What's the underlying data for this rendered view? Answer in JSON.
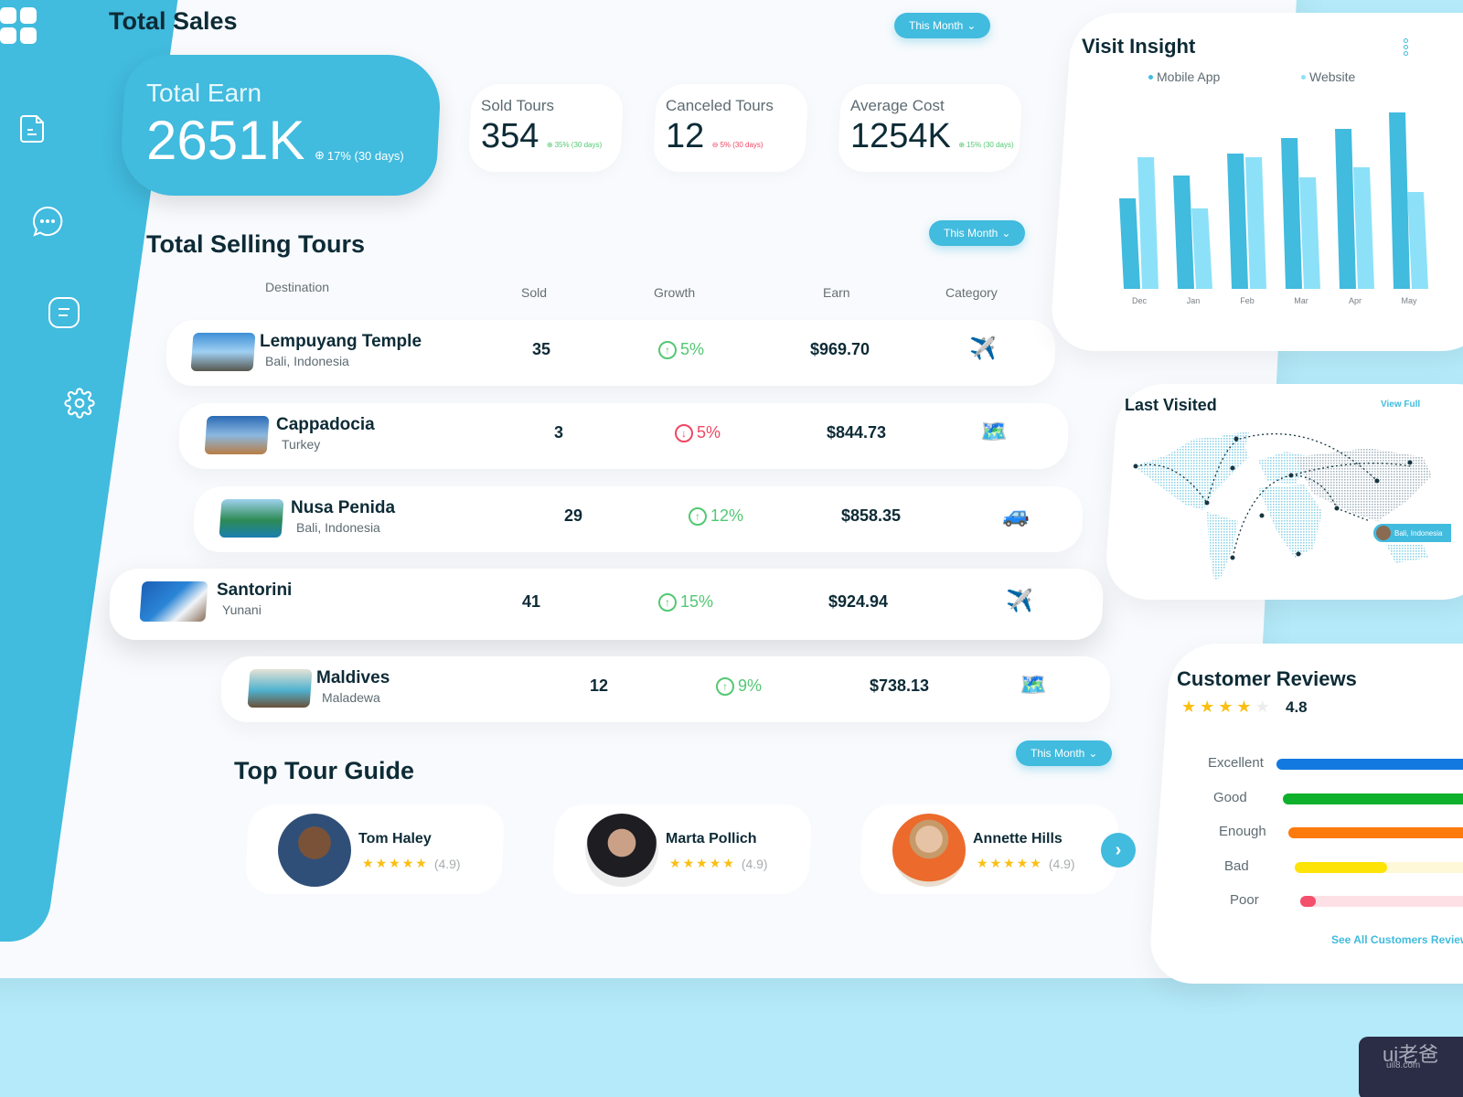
{
  "sidebar": {
    "items": [
      {
        "icon": "document-icon"
      },
      {
        "icon": "chat-icon"
      },
      {
        "icon": "message-icon"
      },
      {
        "icon": "gear-icon"
      }
    ]
  },
  "total_sales": {
    "title": "Total Sales",
    "period_label": "This Month",
    "total_earn": {
      "label": "Total Earn",
      "value": "2651K",
      "delta": "17% (30 days)",
      "trend": "up"
    },
    "stats": [
      {
        "label": "Sold Tours",
        "value": "354",
        "delta": "35% (30 days)",
        "trend": "up"
      },
      {
        "label": "Canceled Tours",
        "value": "12",
        "delta": "5% (30 days)",
        "trend": "down"
      },
      {
        "label": "Average Cost",
        "value": "1254K",
        "delta": "15% (30 days)",
        "trend": "up"
      }
    ]
  },
  "selling_tours": {
    "title": "Total Selling Tours",
    "period_label": "This Month",
    "columns": [
      "Destination",
      "Sold",
      "Growth",
      "Earn",
      "Category"
    ],
    "rows": [
      {
        "name": "Lempuyang Temple",
        "location": "Bali, Indonesia",
        "sold": "35",
        "growth": "5%",
        "trend": "up",
        "earn": "$969.70",
        "category": "✈️",
        "category_name": "flight"
      },
      {
        "name": "Cappadocia",
        "location": "Turkey",
        "sold": "3",
        "growth": "5%",
        "trend": "down",
        "earn": "$844.73",
        "category": "🗺️",
        "category_name": "map"
      },
      {
        "name": "Nusa Penida",
        "location": "Bali, Indonesia",
        "sold": "29",
        "growth": "12%",
        "trend": "up",
        "earn": "$858.35",
        "category": "🚙",
        "category_name": "car"
      },
      {
        "name": "Santorini",
        "location": "Yunani",
        "sold": "41",
        "growth": "15%",
        "trend": "up",
        "earn": "$924.94",
        "category": "✈️",
        "category_name": "flight"
      },
      {
        "name": "Maldives",
        "location": "Maladewa",
        "sold": "12",
        "growth": "9%",
        "trend": "up",
        "earn": "$738.13",
        "category": "🗺️",
        "category_name": "map"
      }
    ]
  },
  "tour_guides": {
    "title": "Top Tour Guide",
    "period_label": "This Month",
    "guides": [
      {
        "name": "Tom Haley",
        "stars": 5,
        "rating": "(4.9)"
      },
      {
        "name": "Marta Pollich",
        "stars": 5,
        "rating": "(4.9)"
      },
      {
        "name": "Annette Hills",
        "stars": 5,
        "rating": "(4.9)"
      }
    ],
    "next_label": "›"
  },
  "visit_insight": {
    "title": "Visit Insight"
  },
  "chart_data": {
    "type": "bar",
    "title": "Visit Insight",
    "categories": [
      "Dec",
      "Jan",
      "Feb",
      "Mar",
      "Apr",
      "May"
    ],
    "series": [
      {
        "name": "Mobile App",
        "color": "#41bbde",
        "values": [
          99,
          124,
          148,
          165,
          175,
          193
        ]
      },
      {
        "name": "Website",
        "color": "#8ce1f8",
        "values": [
          144,
          88,
          144,
          122,
          133,
          106
        ]
      }
    ],
    "xlabel": "",
    "ylabel": "",
    "ylim": [
      0,
      200
    ],
    "grid": false,
    "legend": "top"
  },
  "last_visited": {
    "title": "Last Visited",
    "view_full_label": "View Full",
    "pin_label": "Bali, Indonesia"
  },
  "customer_reviews": {
    "title": "Customer Reviews",
    "stars": 4,
    "rating": "4.8",
    "bars": [
      {
        "label": "Excellent",
        "fill": 1.0,
        "color": "#1279e1",
        "track": "#dbeafb"
      },
      {
        "label": "Good",
        "fill": 1.0,
        "color": "#0fb02c",
        "track": "#d9f3de"
      },
      {
        "label": "Enough",
        "fill": 1.0,
        "color": "#fd7a0c",
        "track": "#ffe9d6"
      },
      {
        "label": "Bad",
        "fill": 0.45,
        "color": "#fde306",
        "track": "#fff8d8"
      },
      {
        "label": "Poor",
        "fill": 0.08,
        "color": "#f44f6c",
        "track": "#fde0e5"
      }
    ],
    "see_all_label": "See All Customers Reviews"
  },
  "watermark": {
    "big": "ui老爸",
    "small": "uil8.com"
  }
}
